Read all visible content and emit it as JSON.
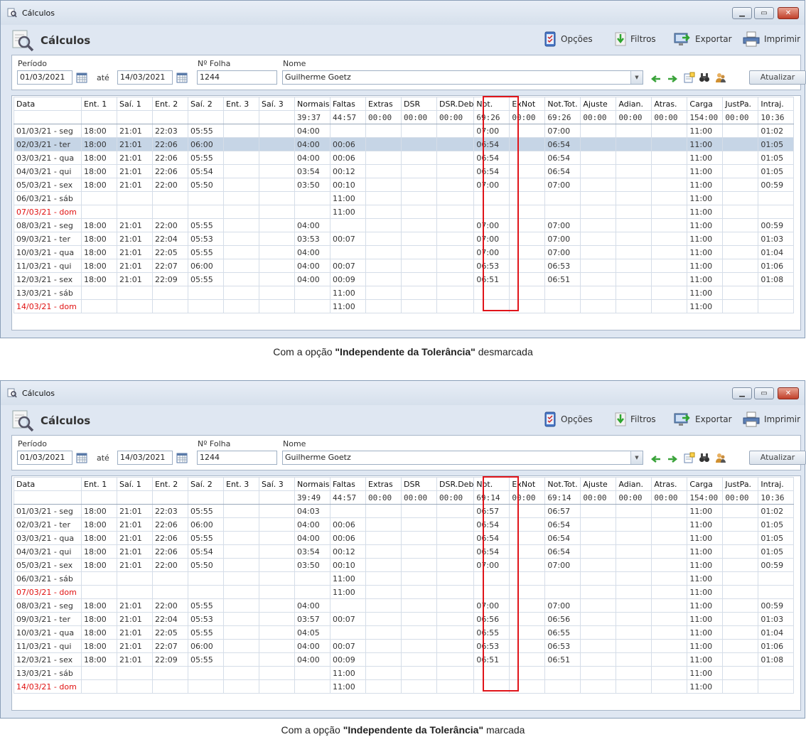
{
  "windows": [
    {
      "title": "Cálculos",
      "header_title": "Cálculos",
      "toolbar": {
        "opcoes": "Opções",
        "filtros": "Filtros",
        "exportar": "Exportar",
        "imprimir": "Imprimir"
      },
      "filters": {
        "periodo_label": "Período",
        "date_from": "01/03/2021",
        "ate_label": "até",
        "date_to": "14/03/2021",
        "folha_label": "Nº Folha",
        "folha_value": "1244",
        "nome_label": "Nome",
        "nome_value": "Guilherme Goetz",
        "atualizar": "Atualizar"
      },
      "columns": [
        "Data",
        "Ent. 1",
        "Saí. 1",
        "Ent. 2",
        "Saí. 2",
        "Ent. 3",
        "Saí. 3",
        "Normais",
        "Faltas",
        "Extras",
        "DSR",
        "DSR.Deb",
        "Not.",
        "ExNot",
        "Not.Tot.",
        "Ajuste",
        "Adian.",
        "Atras.",
        "Carga",
        "JustPa.",
        "Intraj."
      ],
      "totals": [
        "",
        "",
        "",
        "",
        "",
        "",
        "",
        "39:37",
        "44:57",
        "00:00",
        "00:00",
        "00:00",
        "69:26",
        "00:00",
        "69:26",
        "00:00",
        "00:00",
        "00:00",
        "154:00",
        "00:00",
        "10:36"
      ],
      "selected_row": 1,
      "rows": [
        [
          "01/03/21 - seg",
          "18:00",
          "21:01",
          "22:03",
          "05:55",
          "",
          "",
          "04:00",
          "",
          "",
          "",
          "",
          "07:00",
          "",
          "07:00",
          "",
          "",
          "",
          "11:00",
          "",
          "01:02"
        ],
        [
          "02/03/21 - ter",
          "18:00",
          "21:01",
          "22:06",
          "06:00",
          "",
          "",
          "04:00",
          "00:06",
          "",
          "",
          "",
          "06:54",
          "",
          "06:54",
          "",
          "",
          "",
          "11:00",
          "",
          "01:05"
        ],
        [
          "03/03/21 - qua",
          "18:00",
          "21:01",
          "22:06",
          "05:55",
          "",
          "",
          "04:00",
          "00:06",
          "",
          "",
          "",
          "06:54",
          "",
          "06:54",
          "",
          "",
          "",
          "11:00",
          "",
          "01:05"
        ],
        [
          "04/03/21 - qui",
          "18:00",
          "21:01",
          "22:06",
          "05:54",
          "",
          "",
          "03:54",
          "00:12",
          "",
          "",
          "",
          "06:54",
          "",
          "06:54",
          "",
          "",
          "",
          "11:00",
          "",
          "01:05"
        ],
        [
          "05/03/21 - sex",
          "18:00",
          "21:01",
          "22:00",
          "05:50",
          "",
          "",
          "03:50",
          "00:10",
          "",
          "",
          "",
          "07:00",
          "",
          "07:00",
          "",
          "",
          "",
          "11:00",
          "",
          "00:59"
        ],
        [
          "06/03/21 - sáb",
          "",
          "",
          "",
          "",
          "",
          "",
          "",
          "11:00",
          "",
          "",
          "",
          "",
          "",
          "",
          "",
          "",
          "",
          "11:00",
          "",
          ""
        ],
        [
          "07/03/21 - dom",
          "",
          "",
          "",
          "",
          "",
          "",
          "",
          "11:00",
          "",
          "",
          "",
          "",
          "",
          "",
          "",
          "",
          "",
          "11:00",
          "",
          ""
        ],
        [
          "08/03/21 - seg",
          "18:00",
          "21:01",
          "22:00",
          "05:55",
          "",
          "",
          "04:00",
          "",
          "",
          "",
          "",
          "07:00",
          "",
          "07:00",
          "",
          "",
          "",
          "11:00",
          "",
          "00:59"
        ],
        [
          "09/03/21 - ter",
          "18:00",
          "21:01",
          "22:04",
          "05:53",
          "",
          "",
          "03:53",
          "00:07",
          "",
          "",
          "",
          "07:00",
          "",
          "07:00",
          "",
          "",
          "",
          "11:00",
          "",
          "01:03"
        ],
        [
          "10/03/21 - qua",
          "18:00",
          "21:01",
          "22:05",
          "05:55",
          "",
          "",
          "04:00",
          "",
          "",
          "",
          "",
          "07:00",
          "",
          "07:00",
          "",
          "",
          "",
          "11:00",
          "",
          "01:04"
        ],
        [
          "11/03/21 - qui",
          "18:00",
          "21:01",
          "22:07",
          "06:00",
          "",
          "",
          "04:00",
          "00:07",
          "",
          "",
          "",
          "06:53",
          "",
          "06:53",
          "",
          "",
          "",
          "11:00",
          "",
          "01:06"
        ],
        [
          "12/03/21 - sex",
          "18:00",
          "21:01",
          "22:09",
          "05:55",
          "",
          "",
          "04:00",
          "00:09",
          "",
          "",
          "",
          "06:51",
          "",
          "06:51",
          "",
          "",
          "",
          "11:00",
          "",
          "01:08"
        ],
        [
          "13/03/21 - sáb",
          "",
          "",
          "",
          "",
          "",
          "",
          "",
          "11:00",
          "",
          "",
          "",
          "",
          "",
          "",
          "",
          "",
          "",
          "11:00",
          "",
          ""
        ],
        [
          "14/03/21 - dom",
          "",
          "",
          "",
          "",
          "",
          "",
          "",
          "11:00",
          "",
          "",
          "",
          "",
          "",
          "",
          "",
          "",
          "",
          "11:00",
          "",
          ""
        ]
      ],
      "caption": {
        "before": "Com a opção ",
        "bold": "\"Independente da Tolerância\"",
        "after": " desmarcada"
      }
    },
    {
      "title": "Cálculos",
      "header_title": "Cálculos",
      "toolbar": {
        "opcoes": "Opções",
        "filtros": "Filtros",
        "exportar": "Exportar",
        "imprimir": "Imprimir"
      },
      "filters": {
        "periodo_label": "Período",
        "date_from": "01/03/2021",
        "ate_label": "até",
        "date_to": "14/03/2021",
        "folha_label": "Nº Folha",
        "folha_value": "1244",
        "nome_label": "Nome",
        "nome_value": "Guilherme Goetz",
        "atualizar": "Atualizar"
      },
      "columns": [
        "Data",
        "Ent. 1",
        "Saí. 1",
        "Ent. 2",
        "Saí. 2",
        "Ent. 3",
        "Saí. 3",
        "Normais",
        "Faltas",
        "Extras",
        "DSR",
        "DSR.Deb",
        "Not.",
        "ExNot",
        "Not.Tot.",
        "Ajuste",
        "Adian.",
        "Atras.",
        "Carga",
        "JustPa.",
        "Intraj."
      ],
      "totals": [
        "",
        "",
        "",
        "",
        "",
        "",
        "",
        "39:49",
        "44:57",
        "00:00",
        "00:00",
        "00:00",
        "69:14",
        "00:00",
        "69:14",
        "00:00",
        "00:00",
        "00:00",
        "154:00",
        "00:00",
        "10:36"
      ],
      "selected_row": -1,
      "rows": [
        [
          "01/03/21 - seg",
          "18:00",
          "21:01",
          "22:03",
          "05:55",
          "",
          "",
          "04:03",
          "",
          "",
          "",
          "",
          "06:57",
          "",
          "06:57",
          "",
          "",
          "",
          "11:00",
          "",
          "01:02"
        ],
        [
          "02/03/21 - ter",
          "18:00",
          "21:01",
          "22:06",
          "06:00",
          "",
          "",
          "04:00",
          "00:06",
          "",
          "",
          "",
          "06:54",
          "",
          "06:54",
          "",
          "",
          "",
          "11:00",
          "",
          "01:05"
        ],
        [
          "03/03/21 - qua",
          "18:00",
          "21:01",
          "22:06",
          "05:55",
          "",
          "",
          "04:00",
          "00:06",
          "",
          "",
          "",
          "06:54",
          "",
          "06:54",
          "",
          "",
          "",
          "11:00",
          "",
          "01:05"
        ],
        [
          "04/03/21 - qui",
          "18:00",
          "21:01",
          "22:06",
          "05:54",
          "",
          "",
          "03:54",
          "00:12",
          "",
          "",
          "",
          "06:54",
          "",
          "06:54",
          "",
          "",
          "",
          "11:00",
          "",
          "01:05"
        ],
        [
          "05/03/21 - sex",
          "18:00",
          "21:01",
          "22:00",
          "05:50",
          "",
          "",
          "03:50",
          "00:10",
          "",
          "",
          "",
          "07:00",
          "",
          "07:00",
          "",
          "",
          "",
          "11:00",
          "",
          "00:59"
        ],
        [
          "06/03/21 - sáb",
          "",
          "",
          "",
          "",
          "",
          "",
          "",
          "11:00",
          "",
          "",
          "",
          "",
          "",
          "",
          "",
          "",
          "",
          "11:00",
          "",
          ""
        ],
        [
          "07/03/21 - dom",
          "",
          "",
          "",
          "",
          "",
          "",
          "",
          "11:00",
          "",
          "",
          "",
          "",
          "",
          "",
          "",
          "",
          "",
          "11:00",
          "",
          ""
        ],
        [
          "08/03/21 - seg",
          "18:00",
          "21:01",
          "22:00",
          "05:55",
          "",
          "",
          "04:00",
          "",
          "",
          "",
          "",
          "07:00",
          "",
          "07:00",
          "",
          "",
          "",
          "11:00",
          "",
          "00:59"
        ],
        [
          "09/03/21 - ter",
          "18:00",
          "21:01",
          "22:04",
          "05:53",
          "",
          "",
          "03:57",
          "00:07",
          "",
          "",
          "",
          "06:56",
          "",
          "06:56",
          "",
          "",
          "",
          "11:00",
          "",
          "01:03"
        ],
        [
          "10/03/21 - qua",
          "18:00",
          "21:01",
          "22:05",
          "05:55",
          "",
          "",
          "04:05",
          "",
          "",
          "",
          "",
          "06:55",
          "",
          "06:55",
          "",
          "",
          "",
          "11:00",
          "",
          "01:04"
        ],
        [
          "11/03/21 - qui",
          "18:00",
          "21:01",
          "22:07",
          "06:00",
          "",
          "",
          "04:00",
          "00:07",
          "",
          "",
          "",
          "06:53",
          "",
          "06:53",
          "",
          "",
          "",
          "11:00",
          "",
          "01:06"
        ],
        [
          "12/03/21 - sex",
          "18:00",
          "21:01",
          "22:09",
          "05:55",
          "",
          "",
          "04:00",
          "00:09",
          "",
          "",
          "",
          "06:51",
          "",
          "06:51",
          "",
          "",
          "",
          "11:00",
          "",
          "01:08"
        ],
        [
          "13/03/21 - sáb",
          "",
          "",
          "",
          "",
          "",
          "",
          "",
          "11:00",
          "",
          "",
          "",
          "",
          "",
          "",
          "",
          "",
          "",
          "11:00",
          "",
          ""
        ],
        [
          "14/03/21 - dom",
          "",
          "",
          "",
          "",
          "",
          "",
          "",
          "11:00",
          "",
          "",
          "",
          "",
          "",
          "",
          "",
          "",
          "",
          "11:00",
          "",
          ""
        ]
      ],
      "caption": {
        "before": "Com a opção ",
        "bold": "\"Independente da Tolerância\"",
        "after": " marcada"
      }
    }
  ],
  "colors": {
    "highlight_box": "#e0141a",
    "weekend_sunday_text": "#e01010",
    "selected_row": "#c6d5e6"
  },
  "icons": [
    "search-document-icon",
    "options-icon",
    "filter-down-arrow-icon",
    "export-icon",
    "printer-icon",
    "calendar-icon",
    "prev-arrow-icon",
    "next-arrow-icon",
    "detail-icon",
    "binoculars-icon",
    "people-icon"
  ]
}
